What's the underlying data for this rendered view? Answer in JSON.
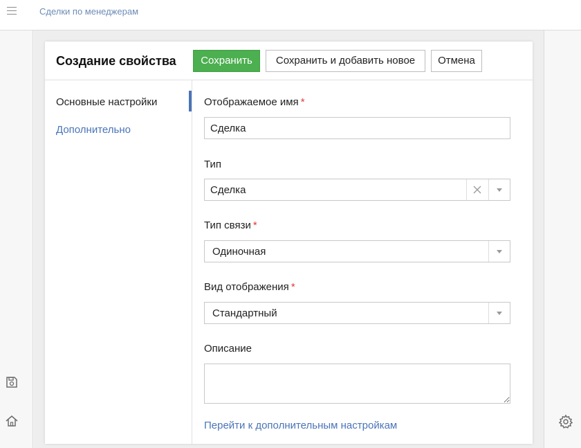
{
  "topbar": {
    "breadcrumb": "Сделки по менеджерам",
    "menu_icon": "hamburger-icon"
  },
  "left_rail": {
    "icons": [
      "save-icon",
      "home-icon"
    ]
  },
  "right_rail": {
    "icons": [
      "gear-icon"
    ]
  },
  "modal": {
    "title": "Создание свойства",
    "buttons": {
      "save": "Сохранить",
      "save_and_new": "Сохранить и добавить новое",
      "cancel": "Отмена"
    },
    "sidebar": {
      "items": [
        {
          "label": "Основные настройки",
          "active": true
        },
        {
          "label": "Дополнительно",
          "active": false
        }
      ]
    },
    "form": {
      "display_name": {
        "label": "Отображаемое имя",
        "required": "*",
        "value": "Сделка"
      },
      "type": {
        "label": "Тип",
        "value": "Сделка"
      },
      "link_type": {
        "label": "Тип связи",
        "required": "*",
        "value": "Одиночная"
      },
      "display_mode": {
        "label": "Вид отображения",
        "required": "*",
        "value": "Стандартный"
      },
      "description": {
        "label": "Описание",
        "value": ""
      },
      "advanced_link": "Перейти к дополнительным настройкам"
    }
  },
  "colors": {
    "primary_button": "#4caf50",
    "accent_link": "#4a74b8",
    "required_star": "#e53935"
  }
}
